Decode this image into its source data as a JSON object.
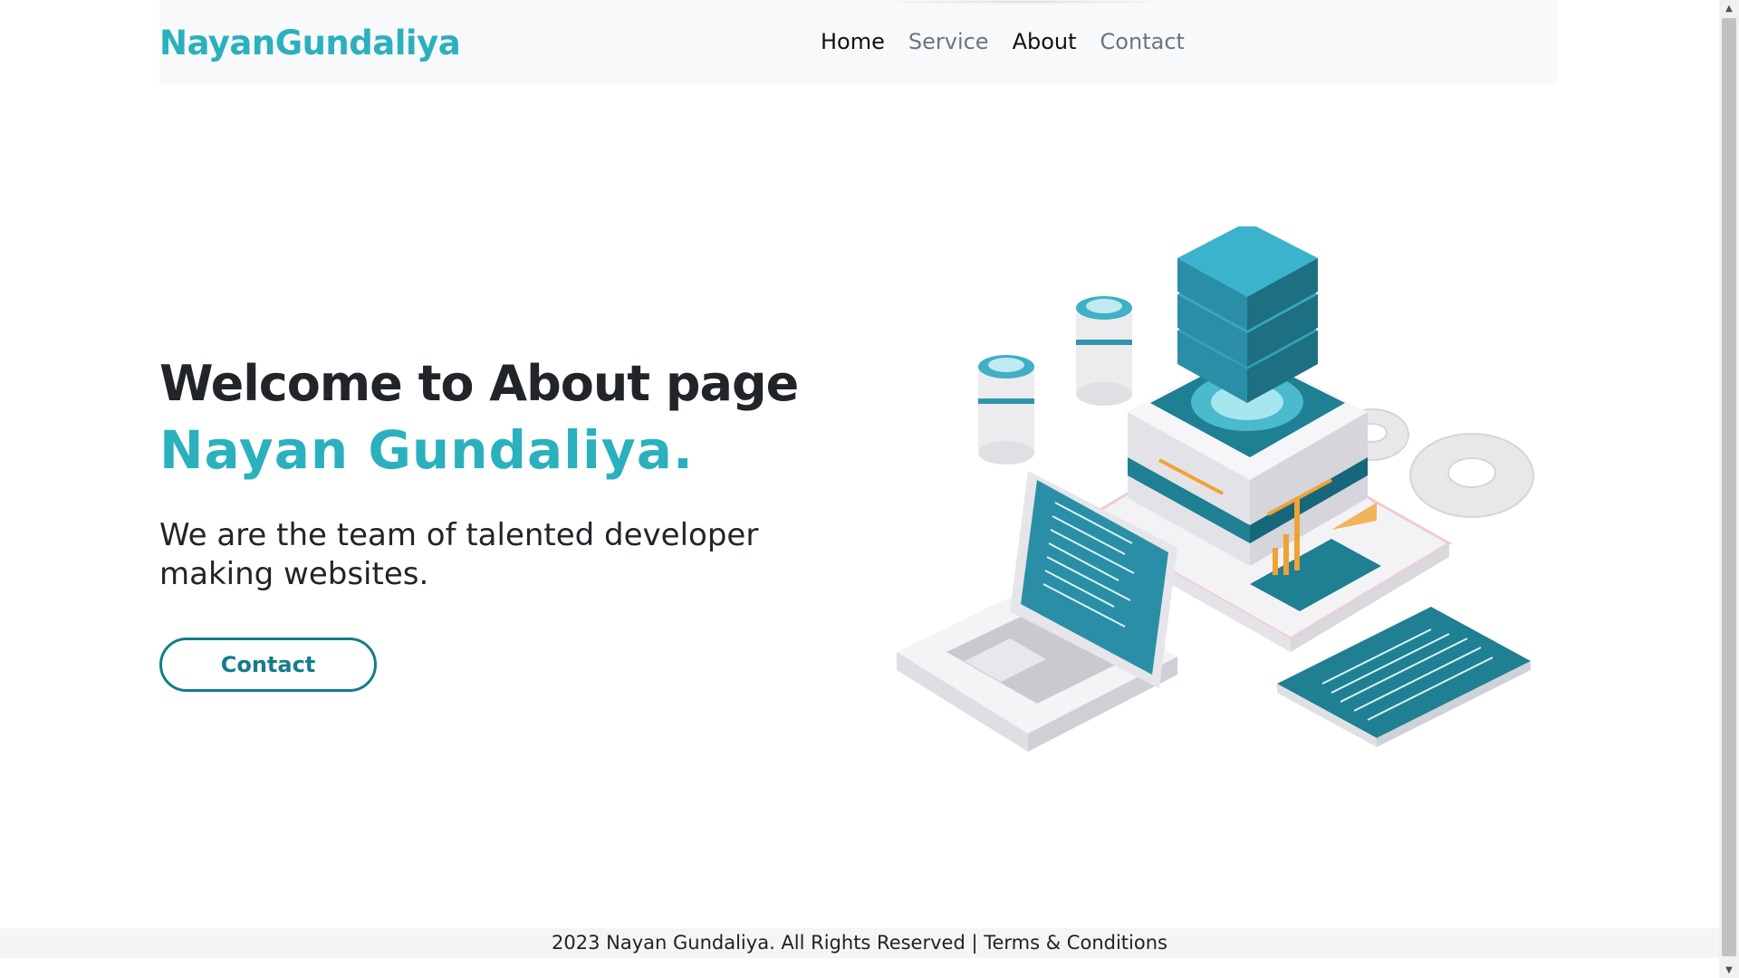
{
  "navbar": {
    "brand": "NayanGundaliya",
    "links": [
      {
        "label": "Home"
      },
      {
        "label": "Service"
      },
      {
        "label": "About"
      },
      {
        "label": "Contact"
      }
    ]
  },
  "hero": {
    "title": "Welcome to About page",
    "name": "Nayan Gundaliya.",
    "description": "We are the team of talented developer making websites.",
    "button_label": "Contact"
  },
  "illustration": {
    "icon": "server-laptop-isometric-illustration"
  },
  "footer": {
    "text": "2023 Nayan Gundaliya. All Rights Reserved |",
    "terms_link": "Terms & Conditions"
  },
  "colors": {
    "accent": "#2bb0be",
    "button_border": "#147c8c",
    "navbar_bg": "#f8f9fa",
    "teal_dark": "#1f7f93",
    "teal_light": "#49b3c8"
  }
}
